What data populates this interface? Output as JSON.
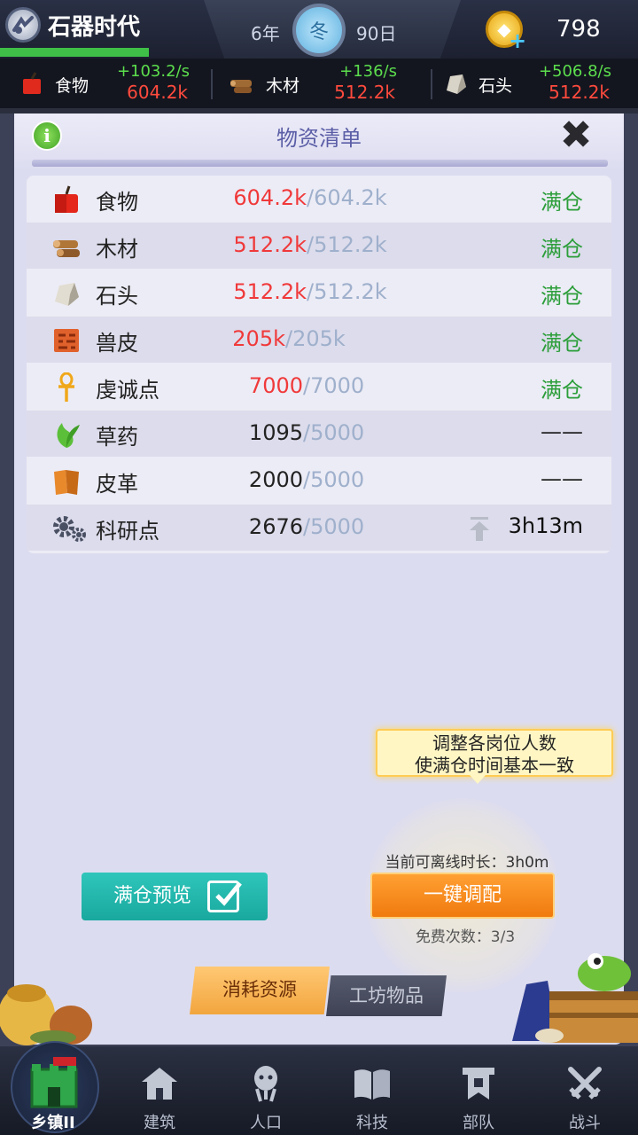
{
  "topbar": {
    "era_title": "石器时代",
    "year": "6年",
    "season": "冬",
    "day": "90日",
    "coins": "798"
  },
  "resource_bar": [
    {
      "name": "食物",
      "rate": "+103.2/s",
      "value": "604.2k",
      "icon": "apple-icon"
    },
    {
      "name": "木材",
      "rate": "+136/s",
      "value": "512.2k",
      "icon": "wood-icon"
    },
    {
      "name": "石头",
      "rate": "+506.8/s",
      "value": "512.2k",
      "icon": "stone-icon"
    }
  ],
  "panel": {
    "title": "物资清单"
  },
  "inventory": [
    {
      "name": "食物",
      "current": "604.2k",
      "max": "/604.2k",
      "status": "满仓",
      "full": true
    },
    {
      "name": "木材",
      "current": "512.2k",
      "max": "/512.2k",
      "status": "满仓",
      "full": true
    },
    {
      "name": "石头",
      "current": "512.2k",
      "max": "/512.2k",
      "status": "满仓",
      "full": true
    },
    {
      "name": "兽皮",
      "current": "205k",
      "max": "/205k",
      "status": "满仓",
      "full": true
    },
    {
      "name": "虔诚点",
      "current": "7000",
      "max": "/7000",
      "status": "满仓",
      "full": true
    },
    {
      "name": "草药",
      "current": "1095",
      "max": "/5000",
      "status": "——",
      "full": false
    },
    {
      "name": "皮革",
      "current": "2000",
      "max": "/5000",
      "status": "——",
      "full": false
    },
    {
      "name": "科研点",
      "current": "2676",
      "max": "/5000",
      "status": "3h13m",
      "full": false
    }
  ],
  "tooltip": {
    "line1": "调整各岗位人数",
    "line2": "使满仓时间基本一致"
  },
  "allocate": {
    "offline_label": "当前可离线时长：3h0m",
    "button_label": "一键调配",
    "free_count": "免费次数：3/3"
  },
  "preview_button": "满仓预览",
  "tabs": {
    "consume": "消耗资源",
    "workshop": "工坊物品"
  },
  "nav": [
    {
      "label": "乡镇II"
    },
    {
      "label": "建筑"
    },
    {
      "label": "人口"
    },
    {
      "label": "科技"
    },
    {
      "label": "部队"
    },
    {
      "label": "战斗"
    }
  ],
  "colors": {
    "full_status": "#2c9e3a",
    "over_value": "#f0393a",
    "rate_green": "#5cde4d",
    "allocate_orange": "#f07a0e",
    "preview_teal": "#19a89e"
  }
}
